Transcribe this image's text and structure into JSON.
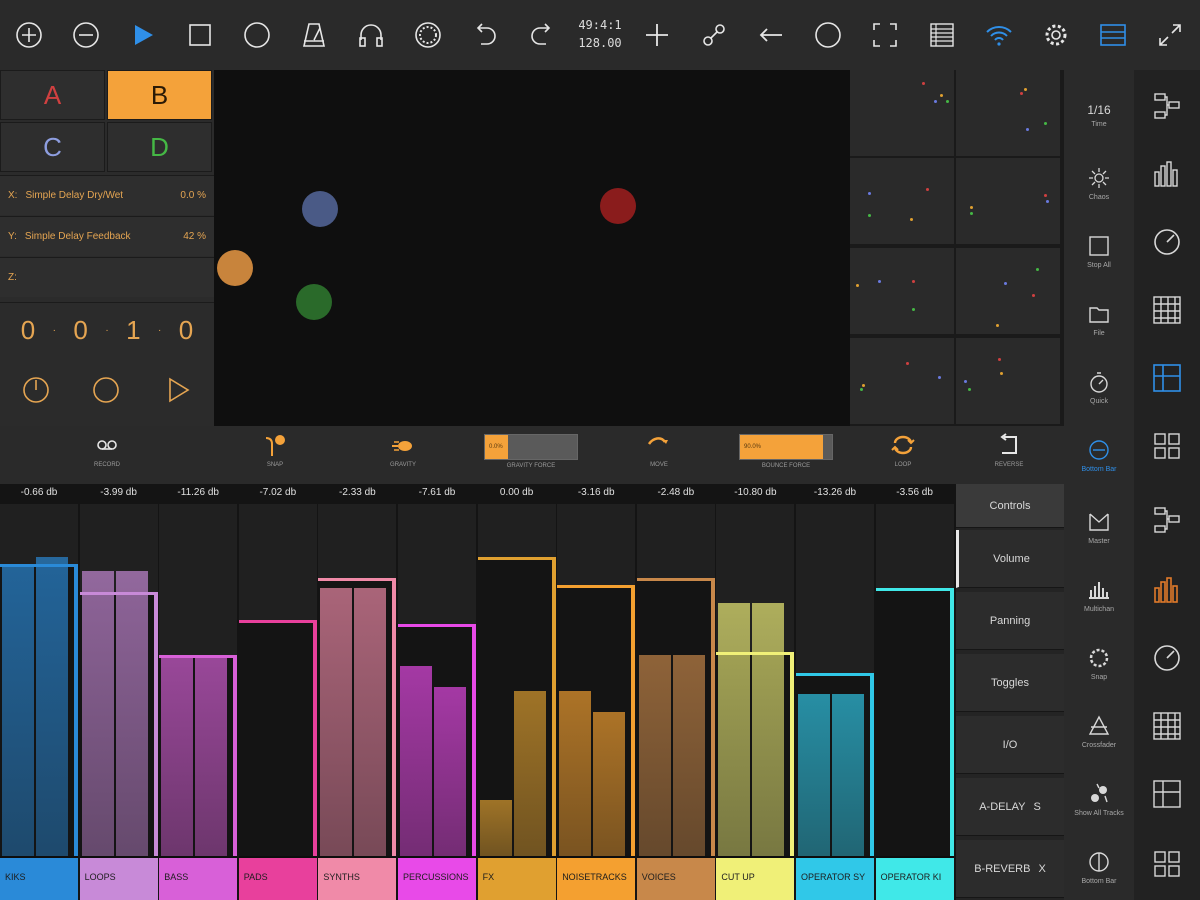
{
  "toolbar": {
    "time_position": "49:4:1",
    "tempo": "128.00",
    "icons": [
      "add-icon",
      "remove-icon",
      "play-icon",
      "stop-icon",
      "record-circle-icon",
      "metronome-icon",
      "headphones-icon",
      "dotted-circle-icon",
      "undo-icon",
      "redo-icon",
      "plus-icon",
      "link-icon",
      "back-arrow-icon",
      "circle-icon",
      "fullscreen-select-icon",
      "list-icon",
      "wifi-icon",
      "gear-icon",
      "menu-icon",
      "expand-icon"
    ],
    "accent_color": "#2f8fe8"
  },
  "left_panel": {
    "buttons": [
      {
        "label": "A",
        "color": "#d04040",
        "active": false
      },
      {
        "label": "B",
        "color": "#2a1a06",
        "active": true
      },
      {
        "label": "C",
        "color": "#8e9ee0",
        "active": false
      },
      {
        "label": "D",
        "color": "#45b845",
        "active": false
      }
    ],
    "x_label": "X:",
    "x_name": "Simple Delay Dry/Wet",
    "x_value": "0.0 %",
    "y_label": "Y:",
    "y_name": "Simple Delay Feedback",
    "y_value": "42 %",
    "z_label": "Z:",
    "counter": [
      "0",
      "0",
      "1",
      "0"
    ],
    "controls": [
      "power-icon",
      "circle-icon",
      "play-outline-icon"
    ]
  },
  "xy_pad": {
    "balls": [
      {
        "id": "blue",
        "color": "#4a5a86"
      },
      {
        "id": "red",
        "color": "#8a1c1c"
      },
      {
        "id": "orange",
        "color": "#c8843c"
      },
      {
        "id": "green",
        "color": "#2a6a2a"
      }
    ]
  },
  "tools": [
    {
      "label": "Time",
      "value": "1/16",
      "icon": "time-value"
    },
    {
      "label": "Chaos",
      "icon": "sun-icon"
    },
    {
      "label": "Stop All",
      "icon": "stop-icon"
    },
    {
      "label": "File",
      "icon": "folder-icon"
    },
    {
      "label": "Quick",
      "icon": "stopwatch-icon"
    },
    {
      "label": "Bottom Bar",
      "icon": "minus-circle-icon",
      "active": true
    },
    {
      "label": "Master",
      "icon": "master-icon"
    },
    {
      "label": "Multichan",
      "icon": "bars-icon"
    },
    {
      "label": "Snap",
      "icon": "snap-icon"
    },
    {
      "label": "Crossfader",
      "icon": "crossfader-icon"
    },
    {
      "label": "Show All Tracks",
      "icon": "tracks-icon"
    },
    {
      "label": "Bottom Bar",
      "icon": "bottom-bar-icon"
    }
  ],
  "nav_icons": [
    "tree-icon",
    "bar-chart-icon",
    "dial-icon",
    "grid-icon",
    "layout-icon",
    "pads-icon",
    "tree-icon",
    "bar-chart-icon",
    "dial-icon",
    "grid-icon",
    "layout-icon",
    "pads-icon"
  ],
  "actions": [
    {
      "label": "RECORD",
      "icon": "tape-icon"
    },
    {
      "label": "SNAP",
      "icon": "snap-icon"
    },
    {
      "label": "GRAVITY",
      "icon": "gravity-icon"
    },
    {
      "label": "GRAVITY FORCE",
      "slider": true,
      "value_text": "0.0%",
      "value": 0.25
    },
    {
      "label": "MOVE",
      "icon": "move-icon"
    },
    {
      "label": "BOUNCE FORCE",
      "slider": true,
      "value_text": "90.0%",
      "value": 0.9
    },
    {
      "label": "LOOP",
      "icon": "loop-icon"
    },
    {
      "label": "REVERSE",
      "icon": "reverse-icon"
    }
  ],
  "mixer": {
    "channels": [
      {
        "name": "KIKS",
        "db": "-0.66 db",
        "color": "#2a8ad8",
        "fader": 0.83,
        "meter": [
          0.83,
          0.85
        ]
      },
      {
        "name": "LOOPS",
        "db": "-3.99 db",
        "color": "#c88ad8",
        "fader": 0.75,
        "meter": [
          0.81,
          0.81
        ]
      },
      {
        "name": "BASS",
        "db": "-11.26 db",
        "color": "#d860d8",
        "fader": 0.57,
        "meter": [
          0.57,
          0.57
        ]
      },
      {
        "name": "PADS",
        "db": "-7.02 db",
        "color": "#e8409c",
        "fader": 0.67,
        "meter": [
          0,
          0
        ]
      },
      {
        "name": "SYNTHS",
        "db": "-2.33 db",
        "color": "#f08aa8",
        "fader": 0.79,
        "meter": [
          0.76,
          0.76
        ]
      },
      {
        "name": "PERCUSSIONS",
        "db": "-7.61 db",
        "color": "#e84ae8",
        "fader": 0.66,
        "meter": [
          0.54,
          0.48
        ]
      },
      {
        "name": "FX",
        "db": "0.00 db",
        "color": "#e0a030",
        "fader": 0.85,
        "meter": [
          0.16,
          0.47
        ]
      },
      {
        "name": "NOISETRACKS",
        "db": "-3.16 db",
        "color": "#f4a030",
        "fader": 0.77,
        "meter": [
          0.47,
          0.41
        ]
      },
      {
        "name": "VOICES",
        "db": "-2.48 db",
        "color": "#c8884a",
        "fader": 0.79,
        "meter": [
          0.57,
          0.57
        ]
      },
      {
        "name": "CUT UP",
        "db": "-10.80 db",
        "color": "#f0f078",
        "fader": 0.58,
        "meter": [
          0.72,
          0.72
        ]
      },
      {
        "name": "OPERATOR SY",
        "db": "-13.26 db",
        "color": "#30c8e8",
        "fader": 0.52,
        "meter": [
          0.46,
          0.46
        ]
      },
      {
        "name": "OPERATOR KI",
        "db": "-3.56 db",
        "color": "#40e8e8",
        "fader": 0.76,
        "meter": [
          0,
          0
        ]
      }
    ]
  },
  "controls_menu": [
    {
      "label": "Controls",
      "active": false
    },
    {
      "label": "Volume",
      "active": true
    },
    {
      "label": "Panning",
      "active": false
    },
    {
      "label": "Toggles",
      "active": false
    },
    {
      "label": "I/O",
      "active": false
    },
    {
      "label": "A-DELAY",
      "suffix": "S",
      "active": false
    },
    {
      "label": "B-REVERB",
      "suffix": "X",
      "active": false
    }
  ]
}
